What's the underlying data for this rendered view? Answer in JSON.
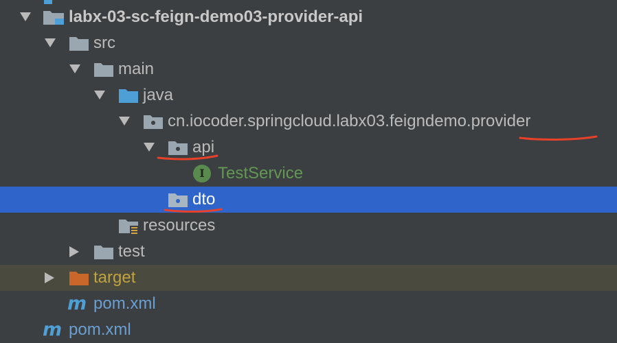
{
  "tree": {
    "module_name": "labx-03-sc-feign-demo03-provider-api",
    "src": "src",
    "main": "main",
    "java": "java",
    "package": "cn.iocoder.springcloud.labx03.feigndemo.provider",
    "api": "api",
    "interface_badge": "I",
    "test_service": "TestService",
    "dto": "dto",
    "resources": "resources",
    "test": "test",
    "target": "target",
    "pom_module": "pom.xml",
    "pom_root": "pom.xml",
    "maven_badge": "m"
  },
  "colors": {
    "background": "#3c3f41",
    "selection": "#2f65ca",
    "excluded": "#4b4a3e",
    "annotation": "#e8412a",
    "folder": "#9aa7b0",
    "source_folder": "#4d9fd5",
    "target_folder": "#c9662a"
  }
}
